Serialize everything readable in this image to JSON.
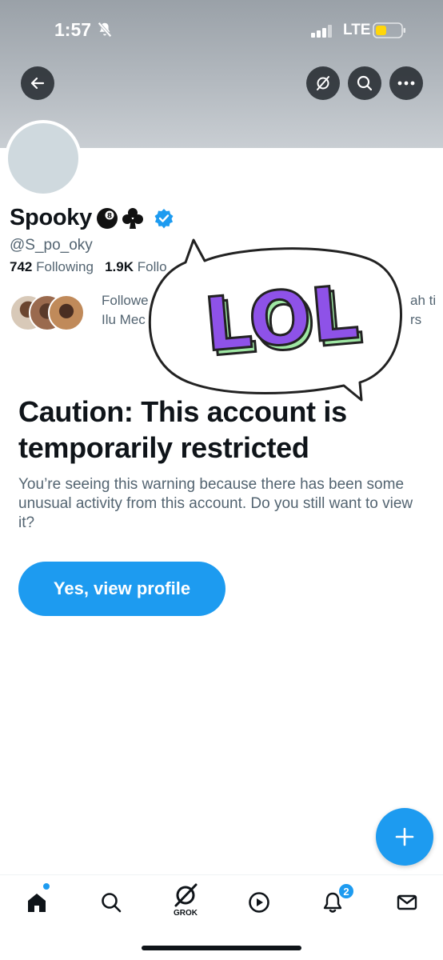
{
  "status_bar": {
    "time": "1:57",
    "network": "LTE"
  },
  "profile": {
    "display_name": "Spooky",
    "name_emojis": [
      "8-ball-emoji",
      "club-suit-emoji"
    ],
    "handle": "@S_po_oky",
    "following_count": "742",
    "following_label": "Following",
    "followers_count": "1.9K",
    "followers_label_visible": "Follo",
    "followed_by_line1_visible": "Followe",
    "followed_by_line1_tail": "ah ti",
    "followed_by_line2_visible": "Ilu Mec",
    "followed_by_line2_tail": "rs"
  },
  "sticker": {
    "text": "LOL",
    "fill_color": "#8e52e8",
    "side_color": "#9fe7a4",
    "outline_color": "#222222"
  },
  "caution": {
    "title": "Caution: This account is temporarily restricted",
    "body": "You’re seeing this warning because there has been some unusual activity from this account. Do you still want to view it?",
    "button_label": "Yes, view profile"
  },
  "tab_bar": {
    "items": [
      "home-icon",
      "search-icon",
      "grok-icon",
      "video-icon",
      "notifications-icon",
      "messages-icon"
    ],
    "grok_label": "GROK",
    "notifications_badge": "2"
  },
  "colors": {
    "accent": "#1d9bf0",
    "text_primary": "#0f1419",
    "text_secondary": "#536471",
    "banner": "#b3b9bf"
  }
}
